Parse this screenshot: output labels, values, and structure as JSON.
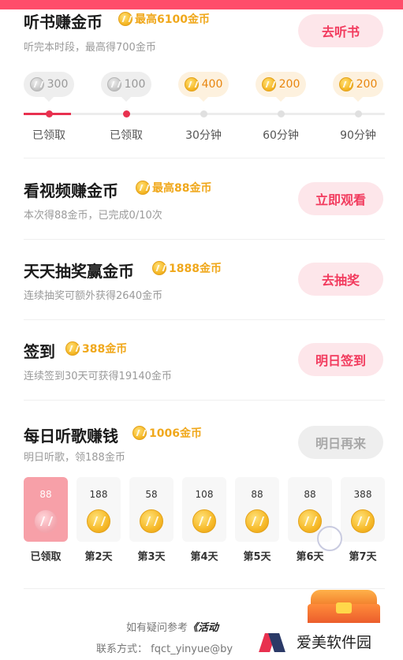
{
  "listen_book": {
    "title": "听书赚金币",
    "reward": "最高6100金币",
    "subtitle": "听完本时段，最高得700金币",
    "button": "去听书",
    "milestones": [
      {
        "amount": "300",
        "label": "已领取",
        "state": "done"
      },
      {
        "amount": "100",
        "label": "已领取",
        "state": "done"
      },
      {
        "amount": "400",
        "label": "30分钟",
        "state": "todo"
      },
      {
        "amount": "200",
        "label": "60分钟",
        "state": "todo"
      },
      {
        "amount": "200",
        "label": "90分钟",
        "state": "todo"
      }
    ]
  },
  "watch_video": {
    "title": "看视频赚金币",
    "reward": "最高88金币",
    "subtitle": "本次得88金币，已完成0/10次",
    "button": "立即观看"
  },
  "lottery": {
    "title": "天天抽奖赢金币",
    "reward": "1888金币",
    "subtitle": "连续抽奖可额外获得2640金币",
    "button": "去抽奖"
  },
  "checkin": {
    "title": "签到",
    "reward": "388金币",
    "subtitle": "连续签到30天可获得19140金币",
    "button": "明日签到"
  },
  "music": {
    "title": "每日听歌赚钱",
    "reward": "1006金币",
    "subtitle": "明日听歌，领188金币",
    "button": "明日再来",
    "days": [
      {
        "amount": "88",
        "label": "已领取",
        "state": "done"
      },
      {
        "amount": "188",
        "label": "第2天",
        "state": "todo"
      },
      {
        "amount": "58",
        "label": "第3天",
        "state": "todo"
      },
      {
        "amount": "108",
        "label": "第4天",
        "state": "todo"
      },
      {
        "amount": "88",
        "label": "第5天",
        "state": "todo"
      },
      {
        "amount": "88",
        "label": "第6天",
        "state": "todo"
      },
      {
        "amount": "388",
        "label": "第7天",
        "state": "todo"
      }
    ]
  },
  "footer": {
    "line1_prefix": "如有疑问参考",
    "line1_link": "《活动",
    "line2": "联系方式： fqct_yinyue@by"
  },
  "watermark": {
    "text": "爱美软件园"
  },
  "colors": {
    "accent": "#f23b5e",
    "gold": "#f0a81c",
    "top_bar": "#ff4d6a"
  },
  "icons": [
    "coin-icon",
    "treasure-chest-icon",
    "watermark-logo-icon"
  ]
}
